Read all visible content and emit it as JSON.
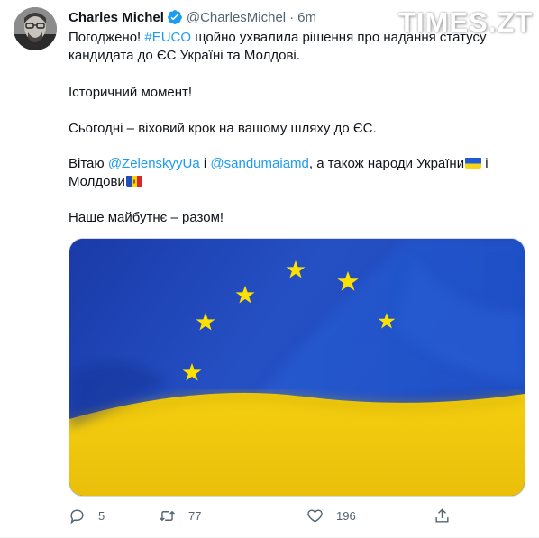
{
  "watermark": {
    "text": "TIMES.ZT"
  },
  "author": {
    "display_name": "Charles Michel",
    "handle": "@CharlesMichel",
    "separator": "·",
    "time": "6m"
  },
  "tweet": {
    "line1_pre": "Погоджено! ",
    "line1_hashtag": "#EUCO",
    "line1_post": " щойно ухвалила рішення про надання статусу",
    "line2": "кандидата до ЄС Україні та Молдові.",
    "para2": "Історичний момент!",
    "para3": "Сьогодні – віховий крок на вашому шляху до ЄС.",
    "para4_pre": "Вітаю ",
    "mention1": "@ZelenskyyUa",
    "para4_mid1": " і ",
    "mention2": "@sandumaiamd",
    "para4_mid2": ", а також народи України",
    "para4_tail": " і",
    "para4_line2": "Молдови",
    "para5": "Наше майбутнє – разом!",
    "flag_ua_emoji": "flag-ukraine-emoji",
    "flag_md_emoji": "flag-moldova-emoji"
  },
  "media": {
    "icon": "eu-ukraine-flag-image",
    "colors": {
      "eu_blue": "#1b3fae",
      "star_yellow": "#ffe100",
      "ua_blue": "#1f5bd6",
      "ua_yellow": "#f7d417"
    }
  },
  "actions": {
    "reply": {
      "icon": "reply-icon",
      "count": "5"
    },
    "retweet": {
      "icon": "retweet-icon",
      "count": "77"
    },
    "like": {
      "icon": "heart-icon",
      "count": "196"
    },
    "share": {
      "icon": "share-icon"
    }
  },
  "colors": {
    "link": "#1d9bf0",
    "secondary_text": "#536471",
    "verified_badge": "#1d9bf0"
  }
}
